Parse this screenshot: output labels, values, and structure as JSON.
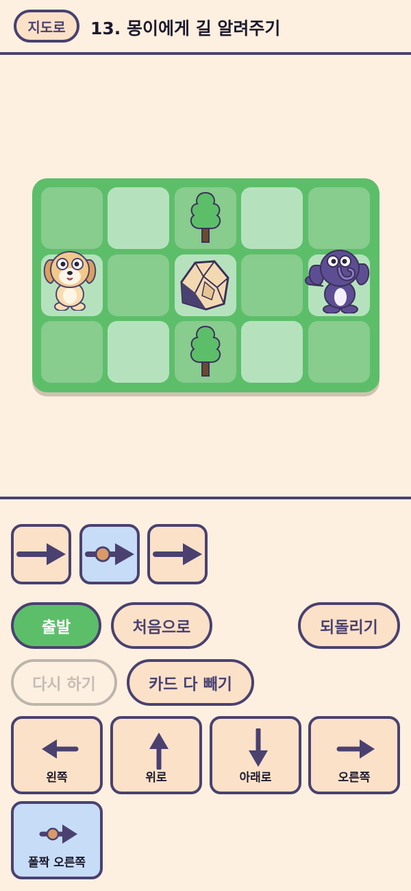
{
  "header": {
    "map_badge": "지도로",
    "title": "13. 몽이에게 길 알려주기"
  },
  "board": {
    "rows": 3,
    "cols": 5,
    "cells": [
      [
        "grass-dark",
        "grass-light",
        "tree",
        "grass-light",
        "grass-dark"
      ],
      [
        "dog",
        "grass-dark",
        "rock",
        "grass-dark",
        "elephant"
      ],
      [
        "grass-dark",
        "grass-light",
        "tree",
        "grass-light",
        "grass-dark"
      ]
    ]
  },
  "program": {
    "cards": [
      {
        "icon": "right-arrow-icon",
        "selected": false
      },
      {
        "icon": "hop-right-arrow-icon",
        "selected": true
      },
      {
        "icon": "right-arrow-icon",
        "selected": false
      }
    ]
  },
  "controls": {
    "start": "출발",
    "reset": "처음으로",
    "undo": "되돌리기",
    "retry": "다시 하기",
    "clear_cards": "카드 다 빼기"
  },
  "directions": {
    "left": "왼쪽",
    "up": "위로",
    "down": "아래로",
    "right": "오른쪽",
    "hop_right": "폴짝 오른쪽"
  },
  "colors": {
    "ink": "#4a4170",
    "background": "#fdf0e0",
    "card": "#fbe1c8",
    "selected_card": "#c7dcf7",
    "board_green": "#5dbe6a"
  }
}
